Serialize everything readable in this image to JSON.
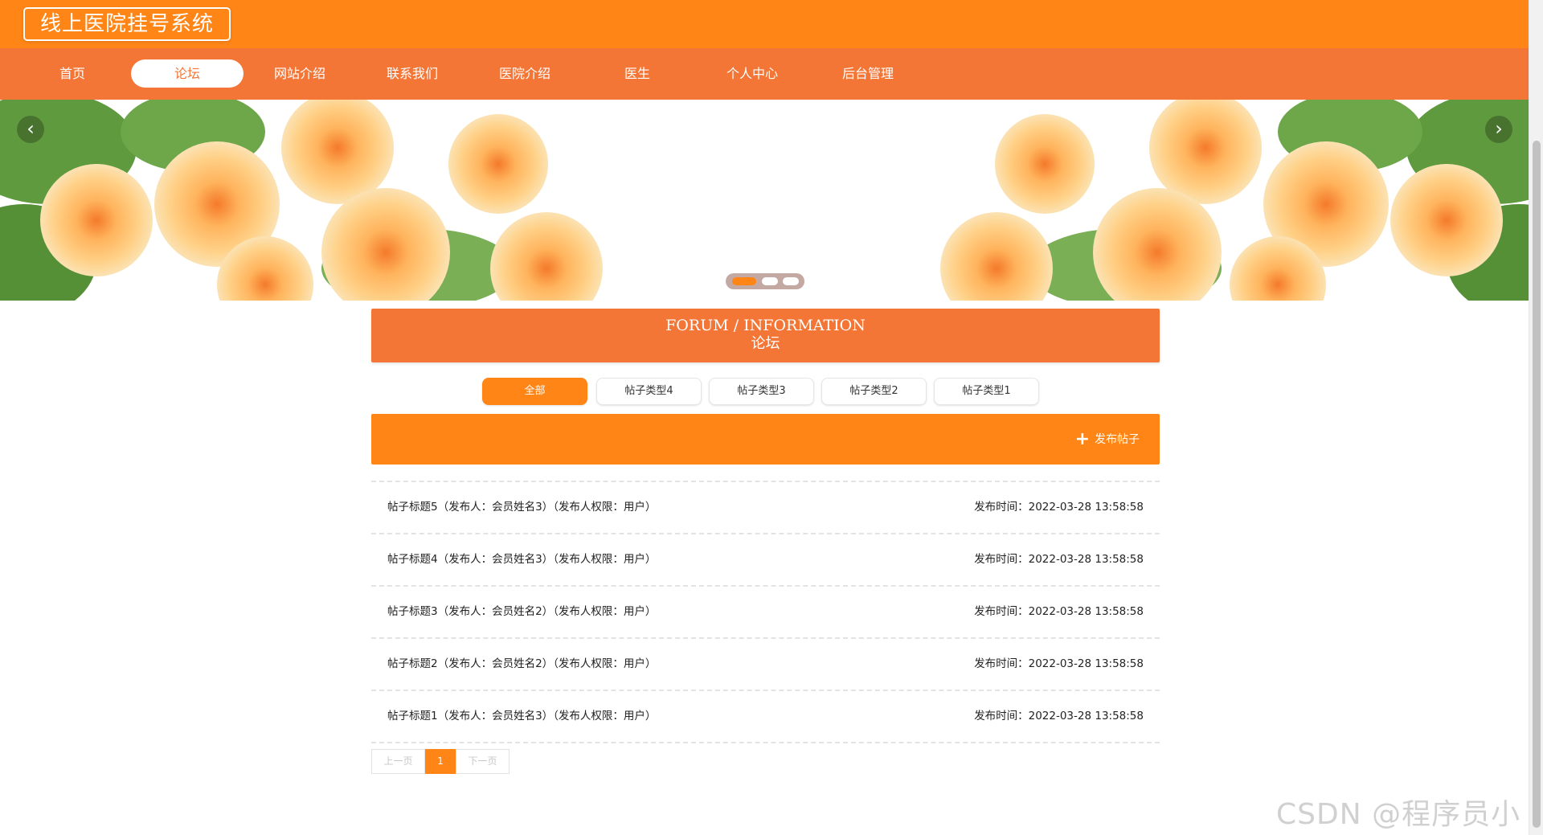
{
  "header": {
    "site_title": "线上医院挂号系统"
  },
  "nav": {
    "items": [
      {
        "label": "首页",
        "active": false
      },
      {
        "label": "论坛",
        "active": true
      },
      {
        "label": "网站介绍",
        "active": false
      },
      {
        "label": "联系我们",
        "active": false
      },
      {
        "label": "医院介绍",
        "active": false
      },
      {
        "label": "医生",
        "active": false
      },
      {
        "label": "个人中心",
        "active": false
      },
      {
        "label": "后台管理",
        "active": false
      }
    ]
  },
  "banner": {
    "prev_icon": "chevron-left-icon",
    "next_icon": "chevron-right-icon",
    "prev_glyph": "‹",
    "next_glyph": "›",
    "slides": 3,
    "active_slide": 1
  },
  "forum": {
    "title_en": "FORUM / INFORMATION",
    "title_cn": "论坛"
  },
  "categories": [
    "全部",
    "帖子类型4",
    "帖子类型3",
    "帖子类型2",
    "帖子类型1"
  ],
  "actions": {
    "post_label": "发布帖子",
    "post_icon": "plus-icon",
    "post_glyph": "+"
  },
  "posts": [
    {
      "title": "帖子标题5（发布人：会员姓名3）（发布人权限：用户）",
      "time": "发布时间：2022-03-28 13:58:58"
    },
    {
      "title": "帖子标题4（发布人：会员姓名3）（发布人权限：用户）",
      "time": "发布时间：2022-03-28 13:58:58"
    },
    {
      "title": "帖子标题3（发布人：会员姓名2）（发布人权限：用户）",
      "time": "发布时间：2022-03-28 13:58:58"
    },
    {
      "title": "帖子标题2（发布人：会员姓名2）（发布人权限：用户）",
      "time": "发布时间：2022-03-28 13:58:58"
    },
    {
      "title": "帖子标题1（发布人：会员姓名3）（发布人权限：用户）",
      "time": "发布时间：2022-03-28 13:58:58"
    }
  ],
  "pagination": {
    "prev": "上一页",
    "current": "1",
    "next": "下一页"
  },
  "watermark": "CSDN @程序员小圆",
  "colors": {
    "primary": "#ff8516",
    "nav": "#f37636",
    "white": "#ffffff"
  }
}
